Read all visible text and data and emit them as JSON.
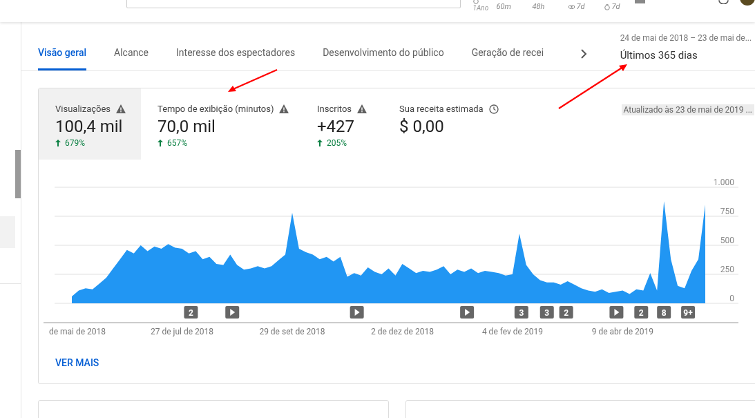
{
  "top_bar": {
    "stats": [
      {
        "kind": "clock",
        "label": "1Ano"
      },
      {
        "kind": "none",
        "label": "60m"
      },
      {
        "kind": "none",
        "label": "48h"
      },
      {
        "kind": "eye",
        "label": "7d"
      },
      {
        "kind": "timer",
        "label": "7d"
      }
    ]
  },
  "tabs": [
    {
      "label": "Visão geral",
      "selected": true
    },
    {
      "label": "Alcance",
      "selected": false
    },
    {
      "label": "Interesse dos espectadores",
      "selected": false
    },
    {
      "label": "Desenvolvimento do público",
      "selected": false
    },
    {
      "label": "Geração de recei",
      "selected": false
    }
  ],
  "date_range": {
    "dates": "24 de mai de 2018 – 23 de mai de...",
    "period": "Últimos 365 dias"
  },
  "metrics": [
    {
      "label": "Visualizações",
      "kind": "warning",
      "value": "100,4 mil",
      "change": "679%",
      "selected": true
    },
    {
      "label": "Tempo de exibição (minutos)",
      "kind": "warning",
      "value": "70,0 mil",
      "change": "657%",
      "selected": false
    },
    {
      "label": "Inscritos",
      "kind": "warning",
      "value": "+427",
      "change": "205%",
      "selected": false
    },
    {
      "label": "Sua receita estimada",
      "kind": "clock",
      "value": "$ 0,00",
      "selected": false
    }
  ],
  "updated": "Atualizado às 23 de mai de 2019 ...",
  "chart": {
    "chart_data": {
      "type": "area",
      "ylim": [
        0,
        1000
      ],
      "grid": true,
      "yticks": [
        0,
        250,
        500,
        750,
        {
          "value": 1000,
          "label": "1.000"
        }
      ],
      "series": [
        {
          "color": "#2196f3",
          "values": [
            60,
            110,
            130,
            120,
            170,
            220,
            300,
            380,
            460,
            430,
            500,
            450,
            490,
            470,
            510,
            480,
            470,
            430,
            450,
            380,
            400,
            340,
            330,
            420,
            330,
            290,
            300,
            320,
            300,
            320,
            370,
            420,
            780,
            470,
            440,
            420,
            380,
            400,
            360,
            400,
            230,
            260,
            240,
            310,
            270,
            250,
            300,
            240,
            340,
            300,
            260,
            280,
            270,
            290,
            320,
            250,
            290,
            270,
            300,
            260,
            280,
            270,
            260,
            240,
            250,
            600,
            330,
            250,
            200,
            180,
            180,
            160,
            190,
            160,
            130,
            110,
            100,
            120,
            90,
            100,
            110,
            80,
            120,
            110,
            260,
            110,
            880,
            380,
            150,
            130,
            280,
            380,
            850
          ]
        }
      ]
    },
    "x_labels": [
      "de mai de 2018",
      "27 de jul de 2018",
      "29 de set de 2018",
      "2 de dez de 2018",
      "4 de fev de 2019",
      "9 de abr de 2019"
    ],
    "markers": [
      {
        "kind": "count",
        "text": "2"
      },
      {
        "kind": "video"
      },
      {
        "kind": "video"
      },
      {
        "kind": "video"
      },
      {
        "kind": "count",
        "text": "3"
      },
      {
        "kind": "count",
        "text": "3"
      },
      {
        "kind": "count",
        "text": "2"
      },
      {
        "kind": "video"
      },
      {
        "kind": "count",
        "text": "2"
      },
      {
        "kind": "count",
        "text": "8"
      },
      {
        "kind": "count",
        "text": "9+"
      }
    ]
  },
  "more_link": "VER MAIS",
  "annotation_arrows": [
    {
      "kind": "arrow"
    },
    {
      "kind": "arrow"
    }
  ]
}
